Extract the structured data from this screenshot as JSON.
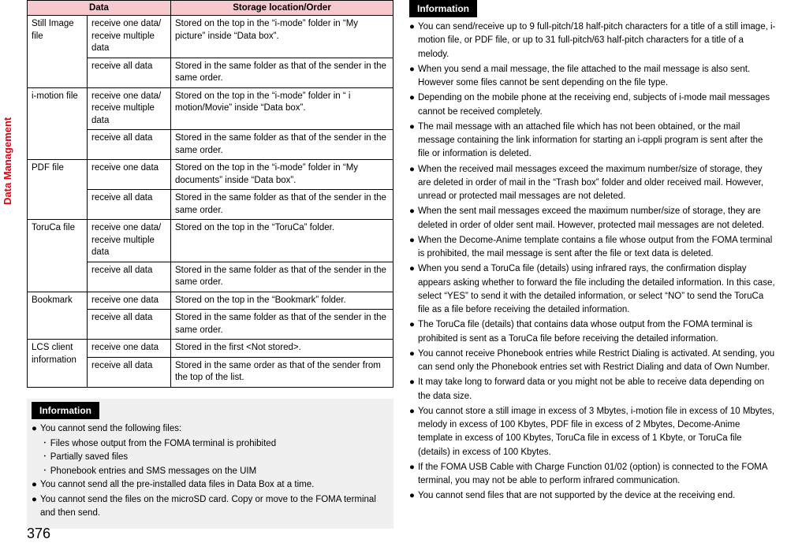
{
  "sideTab": "Data Management",
  "pageNumber": "376",
  "table": {
    "headers": [
      "Data",
      "Storage location/Order"
    ],
    "rows": [
      {
        "c1": "Still Image file",
        "c2": "receive one data/\nreceive multiple data",
        "c3": "Stored on the top in the “i-mode” folder in “My picture” inside “Data box”.",
        "rs": 2
      },
      {
        "c2": "receive all data",
        "c3": "Stored in the same folder as that of the sender in the same order."
      },
      {
        "c1": "i-motion file",
        "c2": "receive one data/\nreceive multiple data",
        "c3": "Stored on the top in the “i-mode” folder in “ i motion/Movie” inside “Data box”.",
        "rs": 2
      },
      {
        "c2": "receive all data",
        "c3": "Stored in the same folder as that of the sender in the same order."
      },
      {
        "c1": "PDF file",
        "c2": "receive one data",
        "c3": "Stored on the top in the “i-mode” folder in “My documents” inside “Data box”.",
        "rs": 2
      },
      {
        "c2": "receive all data",
        "c3": "Stored in the same folder as that of the sender in the same order."
      },
      {
        "c1": "ToruCa file",
        "c2": "receive one data/\nreceive multiple data",
        "c3": "Stored on the top in the “ToruCa” folder.",
        "rs": 2
      },
      {
        "c2": "receive all data",
        "c3": "Stored in the same folder as that of the sender in the same order."
      },
      {
        "c1": "Bookmark",
        "c2": "receive one data",
        "c3": "Stored on the top in the “Bookmark” folder.",
        "rs": 2
      },
      {
        "c2": "receive all data",
        "c3": "Stored in the same folder as that of the sender in the same order."
      },
      {
        "c1": "LCS client information",
        "c2": "receive one data",
        "c3": "Stored in the first <Not stored>.",
        "rs": 2
      },
      {
        "c2": "receive all data",
        "c3": "Stored in the same order as that of the sender from the top of the list."
      }
    ]
  },
  "info1": {
    "title": "Information",
    "items": [
      "You cannot send the following files:",
      "You cannot send all the pre-installed data files in Data Box at a time.",
      "You cannot send the files on the microSD card. Copy or move to the FOMA terminal and then send."
    ],
    "subs": [
      "Files whose output from the FOMA terminal is prohibited",
      "Partially saved files",
      "Phonebook entries and SMS messages on the UIM"
    ]
  },
  "info2": {
    "title": "Information",
    "items": [
      "You can send/receive up to 9 full-pitch/18 half-pitch characters for a title of a still image, i-motion file, or PDF file, or up to 31 full-pitch/63 half-pitch characters for a title of a melody.",
      "When you send a mail message, the file attached to the mail message is also sent. However some files cannot be sent depending on the file type.",
      "Depending on the mobile phone at the receiving end, subjects of i-mode mail messages cannot be received completely.",
      "The mail message with an attached file which has not been obtained, or the mail message containing the link information for starting an i-αppli program is sent after the file or information is deleted.",
      "When the received mail messages exceed the maximum number/size of storage, they are deleted in order of mail in the “Trash box” folder and older received mail. However, unread or protected mail messages are not deleted.",
      "When the sent mail messages exceed the maximum number/size of storage, they are deleted in order of older sent mail. However, protected mail messages are not deleted.",
      "When the Decome-Anime template contains a file whose output from the FOMA terminal is prohibited, the mail message is sent after the file or text data is deleted.",
      "When you send a ToruCa file (details) using infrared rays, the confirmation display appears asking whether to forward the file including the detailed information. In this case, select “YES” to send it with the detailed information, or select “NO” to send the ToruCa file as a file before receiving the detailed information.",
      "The ToruCa file (details) that contains data whose output from the FOMA terminal is prohibited is sent as a ToruCa file before receiving the detailed information.",
      "You cannot receive Phonebook entries while Restrict Dialing is activated. At sending, you can send only the Phonebook entries set with Restrict Dialing and data of Own Number.",
      "It may take long to forward data or you might not be able to receive data depending on the data size.",
      "You cannot store a still image in excess of 3 Mbytes, i-motion file in excess of 10 Mbytes, melody in excess of 100 Kbytes, PDF file in excess of 2 Mbytes, Decome-Anime template in excess of 100 Kbytes, ToruCa file in excess of 1 Kbyte, or ToruCa file (details) in excess of 100 Kbytes.",
      "If the FOMA USB Cable with Charge Function 01/02 (option) is connected to the FOMA terminal, you may not be able to perform infrared communication.",
      "You cannot send files that are not supported by the device at the receiving end."
    ]
  }
}
